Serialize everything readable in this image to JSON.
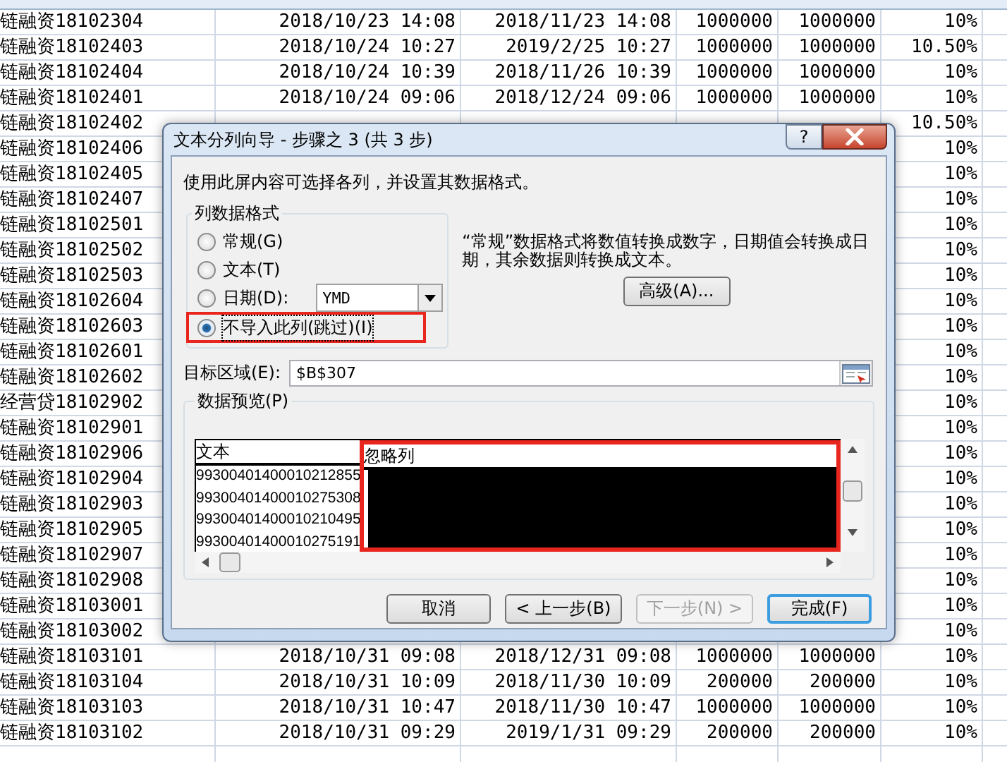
{
  "sheet": {
    "rows": [
      {
        "column_1": "链融资18102304",
        "column_2": "2018/10/23 14:08",
        "column_3": "2018/11/23 14:08",
        "column_4": "1000000",
        "column_5": "1000000",
        "column_6": "10%"
      },
      {
        "column_1": "链融资18102403",
        "column_2": "2018/10/24 10:27",
        "column_3": "2019/2/25 10:27",
        "column_4": "1000000",
        "column_5": "1000000",
        "column_6": "10.50%"
      },
      {
        "column_1": "链融资18102404",
        "column_2": "2018/10/24 10:39",
        "column_3": "2018/11/26 10:39",
        "column_4": "1000000",
        "column_5": "1000000",
        "column_6": "10%"
      },
      {
        "column_1": "链融资18102401",
        "column_2": "2018/10/24 09:06",
        "column_3": "2018/12/24 09:06",
        "column_4": "1000000",
        "column_5": "1000000",
        "column_6": "10%"
      },
      {
        "column_1": "链融资18102402",
        "column_6": "10.50%"
      },
      {
        "column_1": "链融资18102406",
        "column_6": "10%"
      },
      {
        "column_1": "链融资18102405",
        "column_6": "10%"
      },
      {
        "column_1": "链融资18102407",
        "column_6": "10%"
      },
      {
        "column_1": "链融资18102501",
        "column_6": "10%"
      },
      {
        "column_1": "链融资18102502",
        "column_6": "10%"
      },
      {
        "column_1": "链融资18102503",
        "column_6": "10%"
      },
      {
        "column_1": "链融资18102604",
        "column_6": "10%"
      },
      {
        "column_1": "链融资18102603",
        "column_6": "10%"
      },
      {
        "column_1": "链融资18102601",
        "column_6": "10%"
      },
      {
        "column_1": "链融资18102602",
        "column_6": "10%"
      },
      {
        "column_1": "经营贷18102902",
        "column_6": "10%"
      },
      {
        "column_1": "链融资18102901",
        "column_6": "10%"
      },
      {
        "column_1": "链融资18102906",
        "column_6": "10%"
      },
      {
        "column_1": "链融资18102904",
        "column_6": "10%"
      },
      {
        "column_1": "链融资18102903",
        "column_6": "10%"
      },
      {
        "column_1": "链融资18102905",
        "column_6": "10%"
      },
      {
        "column_1": "链融资18102907",
        "column_6": "10%"
      },
      {
        "column_1": "链融资18102908",
        "column_6": "10%"
      },
      {
        "column_1": "链融资18103001",
        "column_6": "10%"
      },
      {
        "column_1": "链融资18103002",
        "column_6": "10%"
      },
      {
        "column_1": "链融资18103101",
        "column_2": "2018/10/31 09:08",
        "column_3": "2018/12/31 09:08",
        "column_4": "1000000",
        "column_5": "1000000",
        "column_6": "10%"
      },
      {
        "column_1": "链融资18103104",
        "column_2": "2018/10/31 10:09",
        "column_3": "2018/11/30 10:09",
        "column_4": "200000",
        "column_5": "200000",
        "column_6": "10%"
      },
      {
        "column_1": "链融资18103103",
        "column_2": "2018/10/31 10:47",
        "column_3": "2018/11/30 10:47",
        "column_4": "1000000",
        "column_5": "1000000",
        "column_6": "10%"
      },
      {
        "column_1": "链融资18103102",
        "column_2": "2018/10/31 09:29",
        "column_3": "2019/1/31 09:29",
        "column_4": "200000",
        "column_5": "200000",
        "column_6": "10%"
      }
    ]
  },
  "dialog": {
    "title": "文本分列向导 - 步骤之 3 (共 3 步)",
    "help_button": "?",
    "instruction": "使用此屏内容可选择各列，并设置其数据格式。",
    "format_group": {
      "label": "列数据格式",
      "date_format": "YMD",
      "options": [
        {
          "kind": "plain",
          "label": "常规(G)",
          "selected": false,
          "highlighted": false
        },
        {
          "kind": "plain",
          "label": "文本(T)",
          "selected": false,
          "highlighted": false
        },
        {
          "kind": "date",
          "label": "日期(D):",
          "selected": false,
          "highlighted": false
        },
        {
          "kind": "plain",
          "label": "不导入此列(跳过)(I)",
          "selected": true,
          "highlighted": true
        }
      ]
    },
    "description": "“常规”数据格式将数值转换成数字，日期值会转换成日期，其余数据则转换成文本。",
    "advanced_button": "高级(A)...",
    "destination": {
      "label": "目标区域(E):",
      "value": "$B$307"
    },
    "preview": {
      "label": "数据预览(P)",
      "columns": [
        {
          "header": "文本",
          "selected": false,
          "highlighted": false,
          "values": [
            "99300401400010212855",
            "99300401400010275308",
            "99300401400010210495",
            "99300401400010275191"
          ]
        },
        {
          "header": "忽略列",
          "selected": true,
          "highlighted": true
        }
      ]
    },
    "buttons": [
      {
        "label": "取消",
        "disabled": false,
        "default": false
      },
      {
        "label": "< 上一步(B)",
        "disabled": false,
        "default": false
      },
      {
        "label": "下一步(N) >",
        "disabled": true,
        "default": false
      },
      {
        "label": "完成(F)",
        "disabled": false,
        "default": true
      }
    ]
  }
}
